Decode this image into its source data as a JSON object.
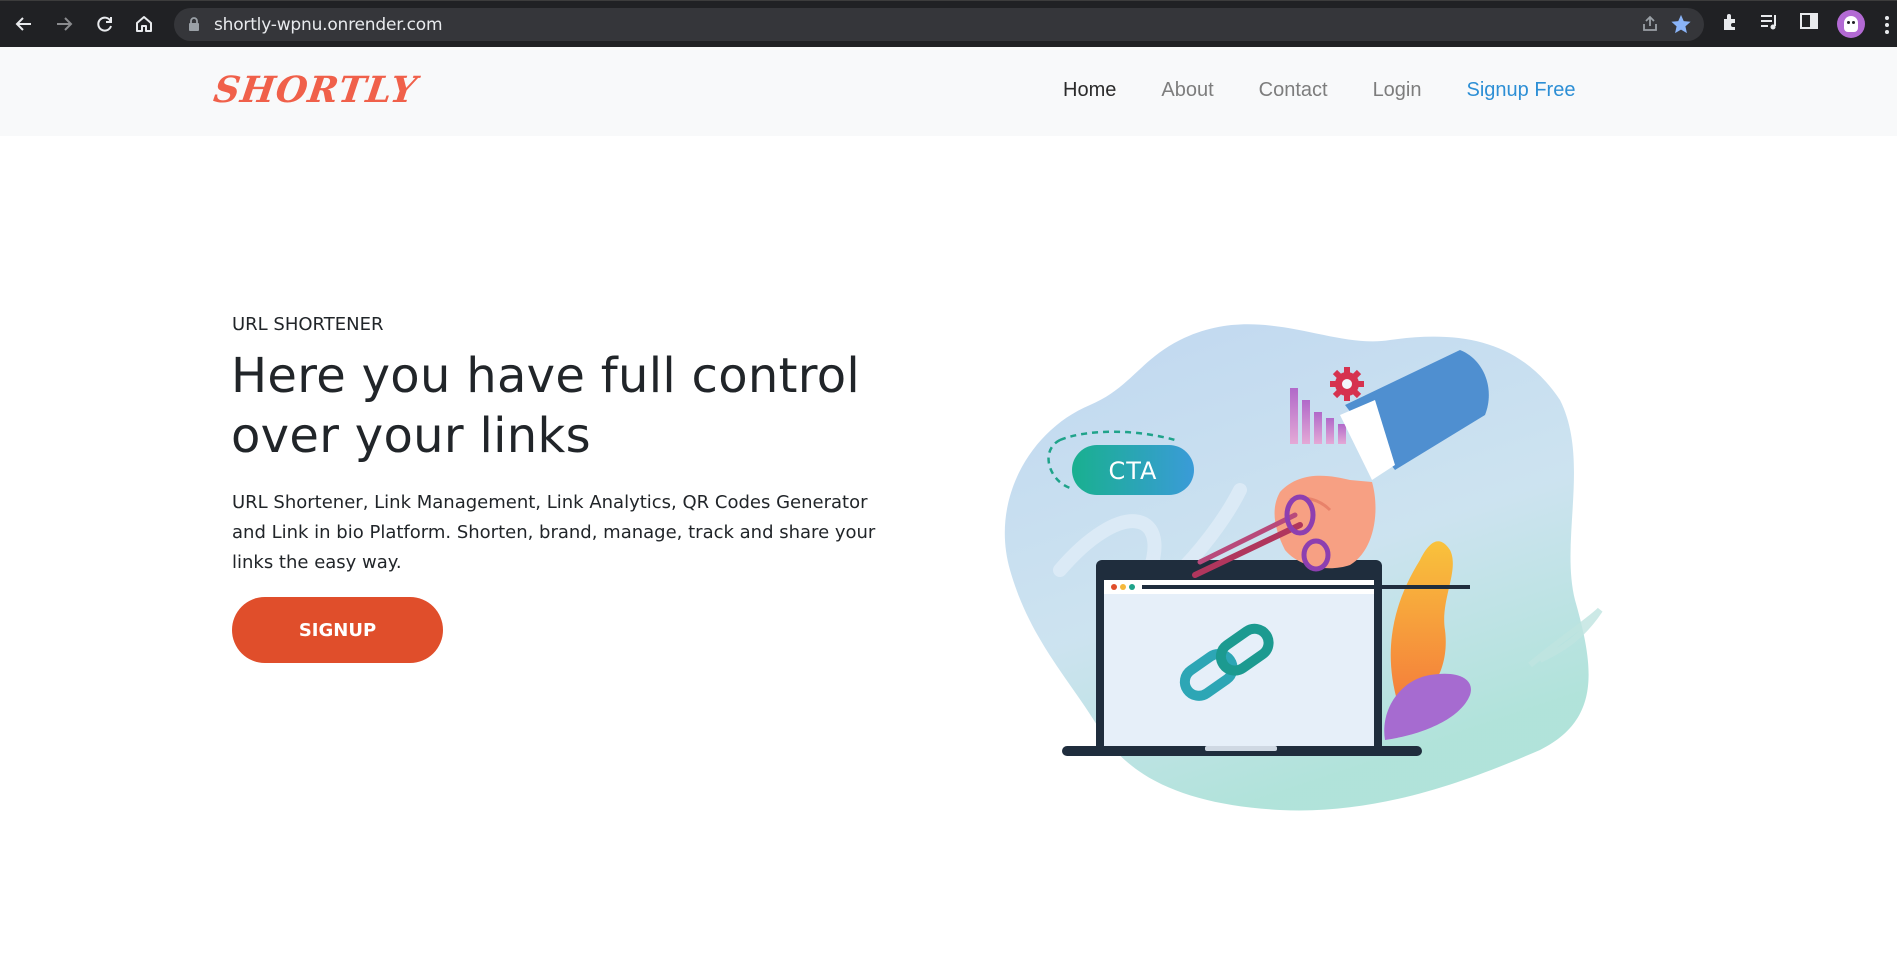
{
  "browser": {
    "url": "shortly-wpnu.onrender.com",
    "icons": [
      "back-icon",
      "forward-icon",
      "reload-icon",
      "home-icon",
      "lock-icon",
      "share-icon",
      "bookmark-star-icon",
      "extensions-icon",
      "media-control-icon",
      "side-panel-icon",
      "profile-avatar",
      "more-menu-icon"
    ]
  },
  "site": {
    "logo": "SHORTLY",
    "nav": {
      "home": "Home",
      "about": "About",
      "contact": "Contact",
      "login": "Login",
      "signup": "Signup Free"
    },
    "colors": {
      "brand": "#f0604a",
      "cta_button": "#e04e2b",
      "nav_link_accent": "#2d8fd5"
    }
  },
  "hero": {
    "eyebrow": "URL SHORTENER",
    "headline_line1": "Here you have full control",
    "headline_line2": "over your links",
    "lead_line1": "URL Shortener, Link Management, Link Analytics, QR Codes Generator",
    "lead_line2": "and Link in bio Platform. Shorten, brand, manage, track and share your",
    "lead_line3": "links the easy way.",
    "button": "SIGNUP"
  },
  "illustration": {
    "cta_pill": "CTA"
  }
}
